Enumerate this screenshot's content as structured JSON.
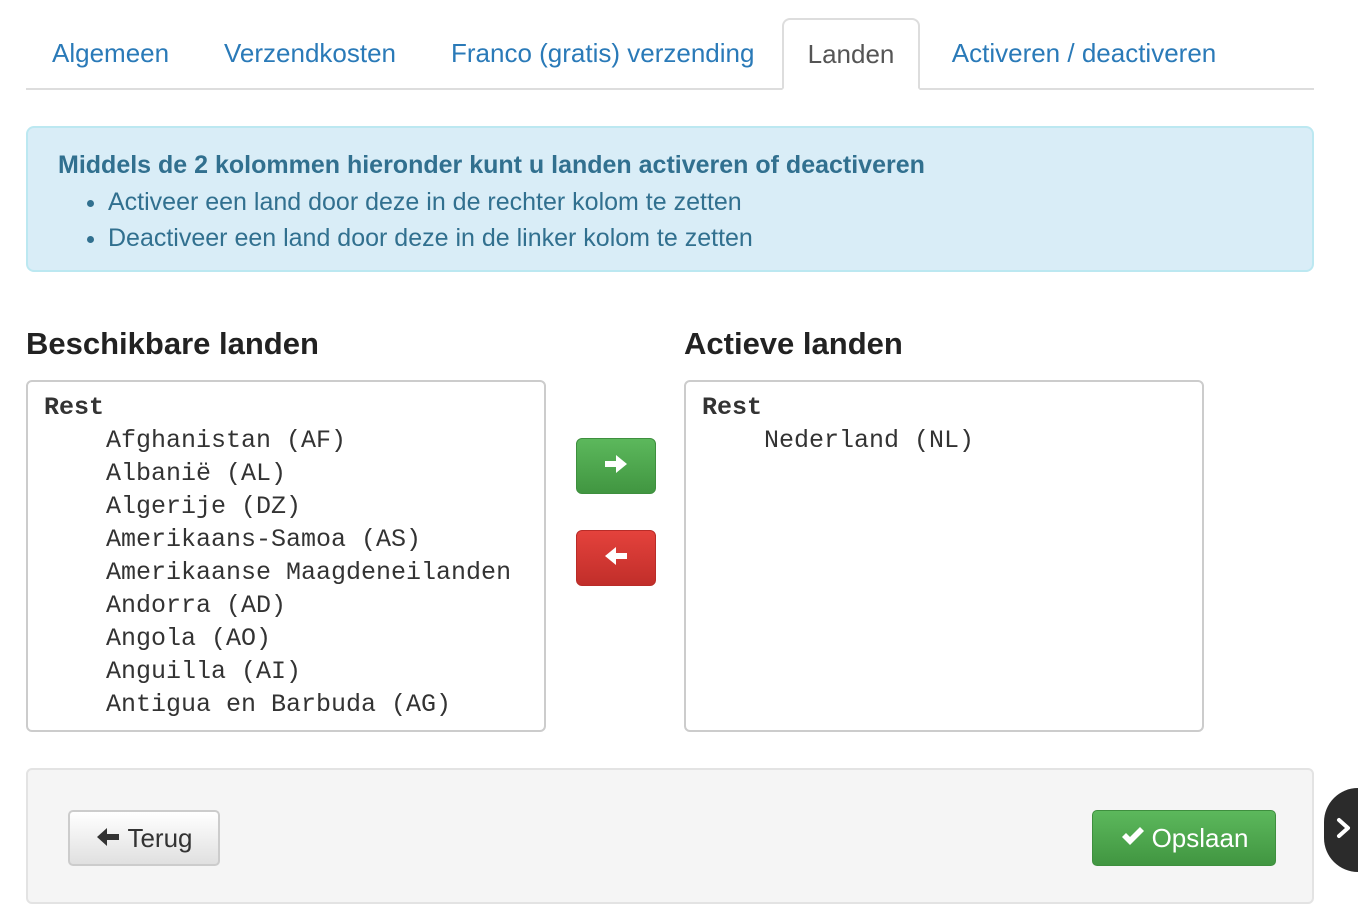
{
  "tabs": [
    {
      "label": "Algemeen",
      "active": false
    },
    {
      "label": "Verzendkosten",
      "active": false
    },
    {
      "label": "Franco (gratis) verzending",
      "active": false
    },
    {
      "label": "Landen",
      "active": true
    },
    {
      "label": "Activeren / deactiveren",
      "active": false
    }
  ],
  "alert": {
    "title": "Middels de 2 kolommen hieronder kunt u landen activeren of deactiveren",
    "items": [
      "Activeer een land door deze in de rechter kolom te zetten",
      "Deactiveer een land door deze in de linker kolom te zetten"
    ]
  },
  "available": {
    "heading": "Beschikbare landen",
    "group_label": "Rest",
    "options": [
      "Afghanistan (AF)",
      "Albanië (AL)",
      "Algerije (DZ)",
      "Amerikaans-Samoa (AS)",
      "Amerikaanse Maagdeneilanden",
      "Andorra (AD)",
      "Angola (AO)",
      "Anguilla (AI)",
      "Antigua en Barbuda (AG)"
    ]
  },
  "active": {
    "heading": "Actieve landen",
    "group_label": "Rest",
    "options": [
      "Nederland (NL)"
    ]
  },
  "move_buttons": {
    "add_icon": "arrow-right-icon",
    "remove_icon": "arrow-left-icon"
  },
  "footer": {
    "back_label": "Terug",
    "back_icon": "arrow-left-icon",
    "save_label": "Opslaan",
    "save_icon": "checkmark-icon"
  },
  "side_handle": {
    "icon": "chevron-right-icon"
  },
  "colors": {
    "link": "#2a7ab8",
    "alert_bg": "#d9edf7",
    "alert_text": "#31708f",
    "success": "#5cb85c",
    "danger": "#d9534f"
  }
}
